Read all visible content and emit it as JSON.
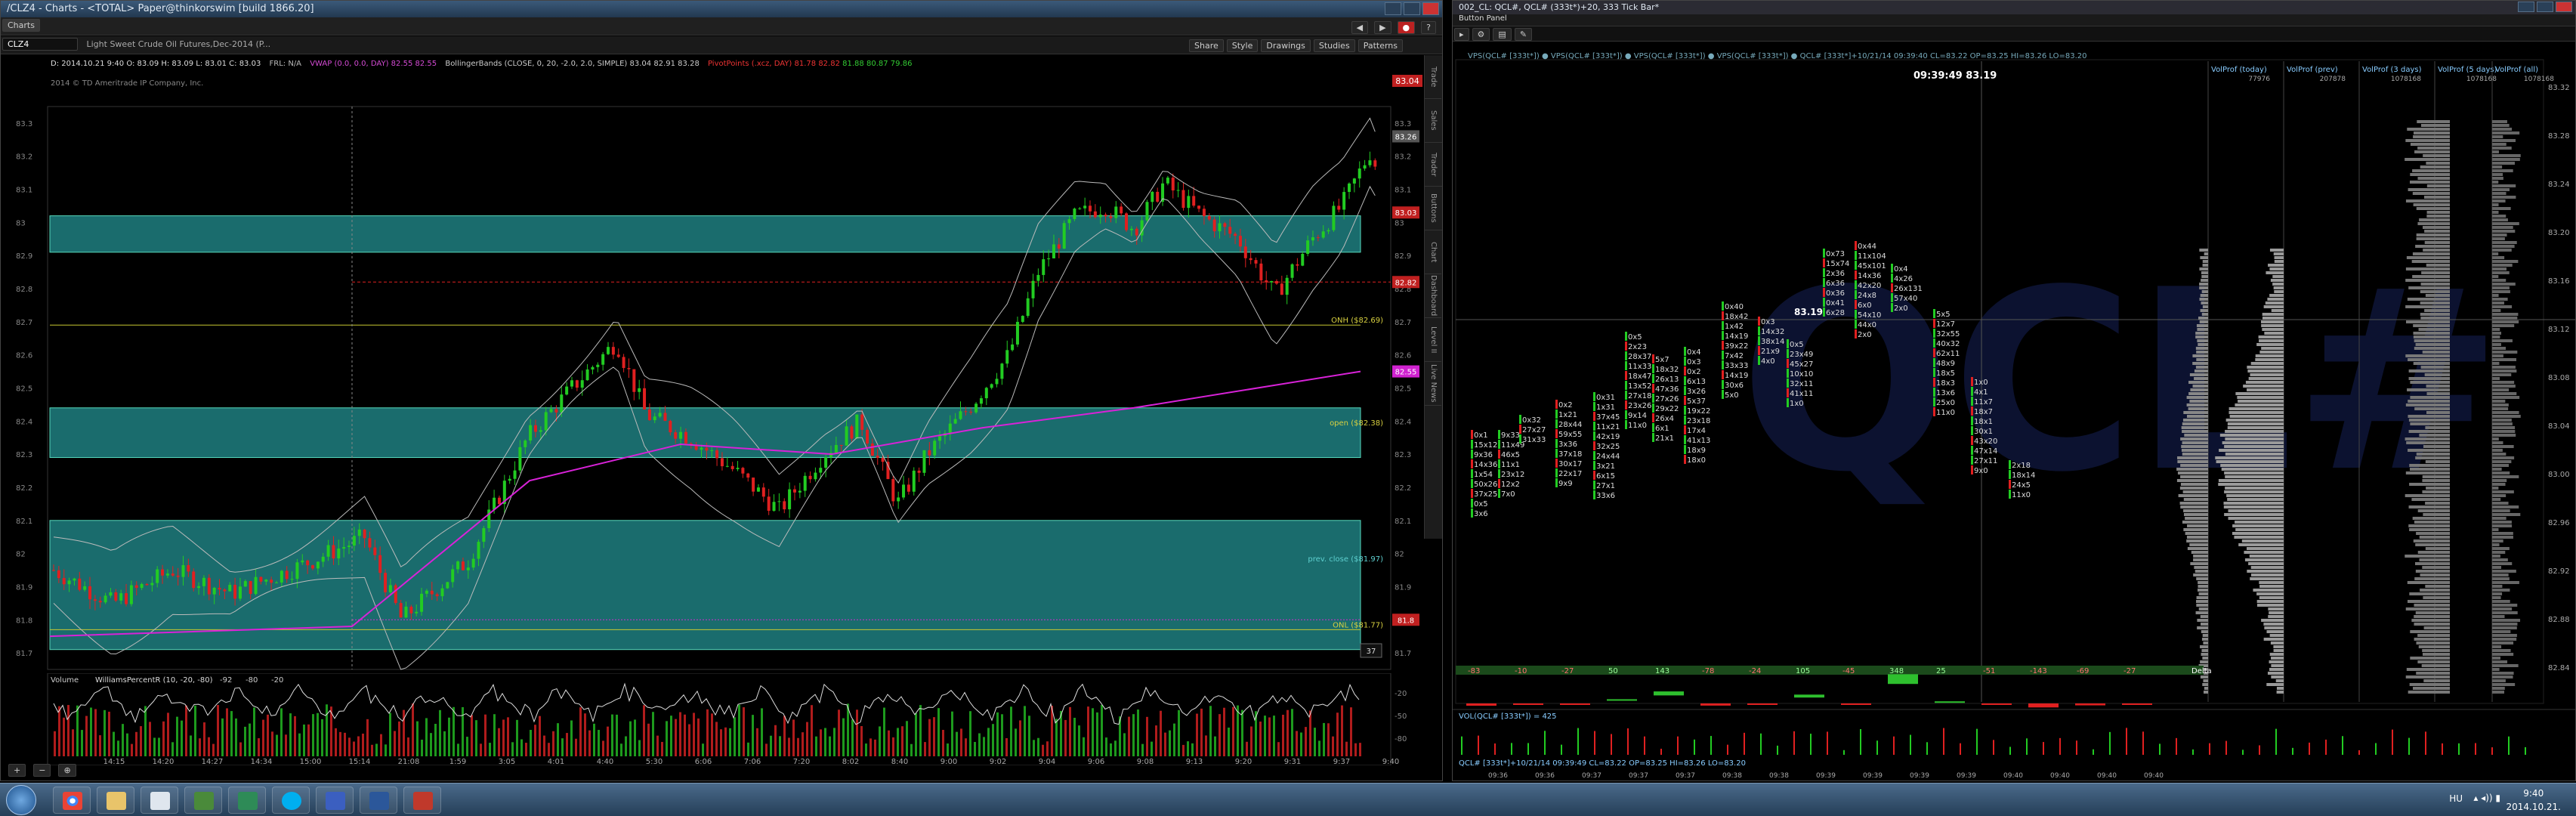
{
  "left_window": {
    "title": "/CLZ4 - Charts - <TOTAL> Paper@thinkorswim [build 1866.20]",
    "tab": "Charts",
    "symbol": "CLZ4",
    "symbol_desc": "Light Sweet Crude Oil Futures,Dec-2014 (P...",
    "bar_info": "D: 2014.10.21 9:40  O: 83.09  H: 83.09  L: 83.01  C: 83.03",
    "copyright": "2014 © TD Ameritrade IP Company, Inc.",
    "toolbar": [
      "Share",
      "Style",
      "Drawings",
      "Studies",
      "Patterns"
    ],
    "studies": [
      "FRL: N/A",
      "VWAP (0.0, 0.0, DAY)",
      "82.55",
      "82.55",
      "BollingerBands (CLOSE, 0, 20, -2.0, 2.0, SIMPLE)",
      "83.04",
      "82.91",
      "83.28",
      "PivotPoints (.xcz, DAY)",
      "81.78",
      "82.82",
      "81.88",
      "80.87",
      "79.86"
    ],
    "price_ticks": [
      "83.3",
      "83.2",
      "83.1",
      "83",
      "82.9",
      "82.8",
      "82.7",
      "82.6",
      "82.5",
      "82.4",
      "82.3",
      "82.2",
      "82.1",
      "82",
      "81.9",
      "81.8",
      "81.7"
    ],
    "price_badges": [
      {
        "label": "83.26",
        "color": "#555555"
      },
      {
        "label": "83.03",
        "color": "#c02020"
      },
      {
        "label": "82.82",
        "color": "#c02020"
      },
      {
        "label": "82.55",
        "color": "#d022d0"
      },
      {
        "label": "81.8",
        "color": "#c02020"
      }
    ],
    "last_price": "83.04",
    "levels": [
      "ONH ($82.69)",
      "open ($82.38)",
      "prev. close ($81.97)",
      "ONL ($81.77)"
    ],
    "counter": "37",
    "lower_panel": {
      "study": "Volume",
      "study2": "WilliamsPercentR (10, -20, -80)",
      "vals": [
        "-92",
        "-80",
        "-20"
      ],
      "ticks": [
        "-20",
        "-50",
        "-80"
      ]
    },
    "time_ticks": [
      "14:15",
      "14:20",
      "14:27",
      "14:34",
      "15:00",
      "15:14",
      "21:08",
      "1:59",
      "3:05",
      "4:01",
      "4:40",
      "5:30",
      "6:06",
      "7:06",
      "7:20",
      "8:02",
      "8:40",
      "9:00",
      "9:02",
      "9:04",
      "9:06",
      "9:08",
      "9:13",
      "9:20",
      "9:31",
      "9:37",
      "9:40"
    ],
    "side_tabs": [
      "Trade",
      "Times And Sales",
      "Active Trader",
      "Big Buttons",
      "Chart",
      "Dashboard",
      "Level II",
      "Live News"
    ]
  },
  "right_window": {
    "title": "002_CL: QCL#, QCL# (333t*)+20, 333 Tick Bar*",
    "button_panel": "Button Panel",
    "header_legend": "VPS(QCL# [333t*]) ● VPS(QCL# [333t*]) ● VPS(QCL# [333t*]) ● VPS(QCL# [333t*]) ● QCL# [333t*]+10/21/14 09:39:40 CL=83.22 OP=83.25 HI=83.26 LO=83.20",
    "cursor_label": "09:39:49 83.19",
    "watermark": "QCL#",
    "profile_headers": [
      "VolProf (today)",
      "VolProf (prev)",
      "VolProf (3 days)",
      "VolProf (5 days)",
      "VolProf (all)"
    ],
    "profile_values": [
      "77976",
      "207878",
      "1078168",
      "1078168",
      "1078168"
    ],
    "price_ticks": [
      "83.32",
      "83.28",
      "83.24",
      "83.20",
      "83.16",
      "83.12",
      "83.08",
      "83.04",
      "83.00",
      "82.96",
      "82.92",
      "82.88",
      "82.84"
    ],
    "delta_values": [
      "-83",
      "-10",
      "-27",
      "50",
      "143",
      "-78",
      "-24",
      "105",
      "-45",
      "348",
      "25",
      "-51",
      "-143",
      "-69",
      "-27"
    ],
    "delta_label": "Delta",
    "vol_legend": "VOL(QCL# [333t*]) = 425",
    "bottom_legend": "QCL# [333t*]+10/21/14 09:39:49 CL=83.22 OP=83.25 HI=83.26 LO=83.20",
    "time_ticks": [
      "09:36",
      "09:36",
      "09:37",
      "09:37",
      "09:37",
      "09:38",
      "09:38",
      "09:39",
      "09:39",
      "09:39",
      "09:39",
      "09:40",
      "09:40",
      "09:40",
      "09:40"
    ],
    "footprint_last": "83.19",
    "fp_cols": [
      [
        "0x1",
        "15x12",
        "9x36",
        "14x36",
        "1x54",
        "50x26",
        "37x25",
        "0x5",
        "3x6"
      ],
      [
        "9x33",
        "11x49",
        "46x5",
        "11x1",
        "23x12",
        "12x2",
        "7x0"
      ],
      [
        "0x32",
        "27x27",
        "31x33"
      ],
      [
        "0x2",
        "1x21",
        "28x44",
        "59x55",
        "3x36",
        "37x18",
        "30x17",
        "22x17",
        "9x9"
      ],
      [
        "0x31",
        "1x31",
        "37x45",
        "11x21",
        "42x19",
        "32x25",
        "24x44",
        "3x21",
        "6x15",
        "27x1",
        "33x6"
      ],
      [
        "0x5",
        "2x23",
        "28x37",
        "11x33",
        "18x47",
        "13x52",
        "27x18",
        "23x26",
        "9x14",
        "11x0"
      ],
      [
        "5x7",
        "18x32",
        "26x13",
        "47x36",
        "27x26",
        "29x22",
        "26x4",
        "6x1",
        "21x1"
      ],
      [
        "0x4",
        "0x3",
        "0x2",
        "6x13",
        "3x26",
        "5x37",
        "19x22",
        "23x18",
        "17x4",
        "41x13",
        "18x9",
        "18x0"
      ],
      [
        "0x40",
        "18x42",
        "1x42",
        "14x19",
        "39x22",
        "7x42",
        "33x33",
        "14x19",
        "30x6",
        "5x0"
      ],
      [
        "0x3",
        "14x32",
        "38x14",
        "21x9",
        "4x0"
      ],
      [
        "0x5",
        "23x49",
        "45x27",
        "10x10",
        "32x11",
        "41x11",
        "1x0"
      ],
      [
        "0x73",
        "15x74",
        "2x36",
        "6x36",
        "0x36",
        "0x41",
        "6x28"
      ],
      [
        "0x44",
        "11x104",
        "45x101",
        "14x36",
        "42x20",
        "24x8",
        "6x0",
        "54x10",
        "44x0",
        "2x0"
      ],
      [
        "0x4",
        "4x26",
        "26x131",
        "57x40",
        "2x0"
      ],
      [
        "5x5",
        "12x7",
        "32x55",
        "40x32",
        "62x11",
        "48x9",
        "18x5",
        "18x3",
        "13x6",
        "25x0",
        "11x0"
      ],
      [
        "1x0",
        "4x1",
        "11x7",
        "18x7",
        "18x1",
        "30x1",
        "43x20",
        "47x14",
        "27x11",
        "9x0"
      ],
      [
        "2x18",
        "18x14",
        "24x5",
        "11x0"
      ]
    ]
  },
  "taskbar": {
    "lang": "HU",
    "time": "9:40",
    "date": "2014.10.21."
  }
}
